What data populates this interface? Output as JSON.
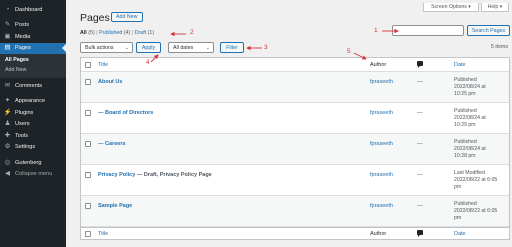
{
  "screen_options": "Screen Options ▾",
  "help": "Help ▾",
  "sidebar": {
    "items": [
      {
        "label": "Dashboard",
        "icon": "dashboard-icon",
        "glyph": "◔"
      },
      {
        "label": "Posts",
        "icon": "pushpin-icon",
        "glyph": "✎"
      },
      {
        "label": "Media",
        "icon": "media-icon",
        "glyph": "▣"
      },
      {
        "label": "Pages",
        "icon": "pages-icon",
        "glyph": "▤"
      }
    ],
    "submenu": [
      "All Pages",
      "Add New"
    ],
    "items2": [
      {
        "label": "Comments",
        "icon": "comments-icon",
        "glyph": "✉"
      },
      {
        "label": "Appearance",
        "icon": "appearance-icon",
        "glyph": "✦"
      },
      {
        "label": "Plugins",
        "icon": "plugins-icon",
        "glyph": "⚡"
      },
      {
        "label": "Users",
        "icon": "users-icon",
        "glyph": "♟"
      },
      {
        "label": "Tools",
        "icon": "tools-icon",
        "glyph": "✚"
      },
      {
        "label": "Settings",
        "icon": "settings-icon",
        "glyph": "⚙"
      },
      {
        "label": "Gutenberg",
        "icon": "gutenberg-icon",
        "glyph": "◎"
      },
      {
        "label": "Collapse menu",
        "icon": "collapse-icon",
        "glyph": "◀"
      }
    ]
  },
  "header": {
    "title": "Pages",
    "add_new": "Add New"
  },
  "filters": {
    "all": "All",
    "all_count": "(5)",
    "published": "Published",
    "published_count": "(4)",
    "draft": "Draft",
    "draft_count": "(1)",
    "sep": "|"
  },
  "search": {
    "value": "",
    "button": "Search Pages"
  },
  "bulk_actions": "Bulk actions",
  "apply": "Apply",
  "all_dates": "All dates",
  "filter": "Filter",
  "items_count": "5 items",
  "table": {
    "col_title": "Title",
    "col_author": "Author",
    "col_date": "Date",
    "rows": [
      {
        "title": "About Us",
        "state": "",
        "author": "fpraseeth",
        "comments": "—",
        "status": "Published",
        "date": "2022/08/24 at",
        "time": "10:25 pm"
      },
      {
        "title": "— Board of Directors",
        "state": "",
        "author": "fpraseeth",
        "comments": "—",
        "status": "Published",
        "date": "2022/08/24 at",
        "time": "10:29 pm"
      },
      {
        "title": "— Careers",
        "state": "",
        "author": "fpraseeth",
        "comments": "—",
        "status": "Published",
        "date": "2022/08/24 at",
        "time": "10:28 pm"
      },
      {
        "title": "Privacy Policy",
        "state": " — Draft, Privacy Policy Page",
        "author": "fpraseeth",
        "comments": "—",
        "status": "Last Modified",
        "date": "2022/08/22 at 6:05",
        "time": "pm"
      },
      {
        "title": "Sample Page",
        "state": "",
        "author": "fpraseeth",
        "comments": "—",
        "status": "Published",
        "date": "2022/08/22 at 6:05",
        "time": "pm"
      }
    ]
  },
  "annotations": {
    "n1": "1",
    "n2": "2",
    "n3": "3",
    "n4": "4",
    "n5": "5",
    "color": "#d63638"
  },
  "colors": {
    "sidebar_bg": "#1d2327",
    "accent": "#2271b1",
    "page_bg": "#f0f0f1"
  }
}
